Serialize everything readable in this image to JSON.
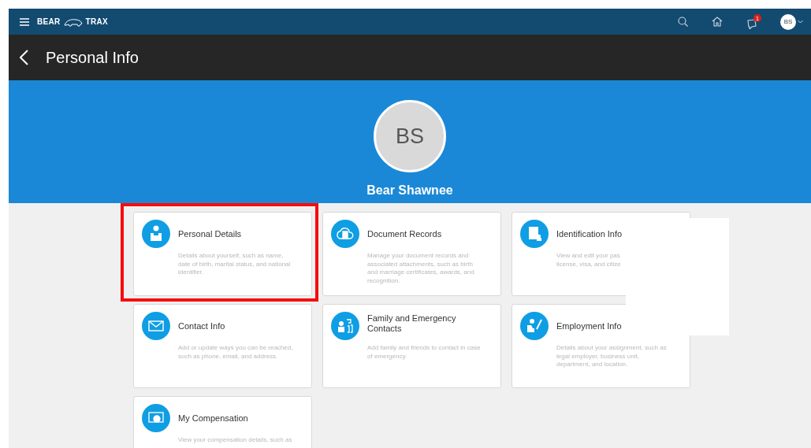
{
  "app_bar": {
    "brand_left": "BEAR",
    "brand_right": "TRAX",
    "notification_count": "1",
    "user_initials": "BS"
  },
  "page": {
    "title": "Personal Info"
  },
  "profile": {
    "initials": "BS",
    "name": "Bear Shawnee"
  },
  "cards": [
    {
      "kind": "person",
      "title": "Personal Details",
      "description_lines": [
        "Details about yourself, such as name,",
        "date of birth, marital status, and national",
        "identifier."
      ],
      "highlighted": true
    },
    {
      "kind": "cloud",
      "title": "Document Records",
      "description_lines": [
        "Manage your document records and",
        "associated attachments, such as birth",
        "and marriage certificates, awards, and",
        "recognition."
      ],
      "highlighted": false
    },
    {
      "kind": "id",
      "title": "Identification Info",
      "description_lines": [
        "View and edit your pas",
        "license, visa, and citize"
      ],
      "highlighted": false
    },
    {
      "kind": "mail",
      "title": "Contact Info",
      "description_lines": [
        "Add or update ways you can be reached,",
        "such as phone, email, and address."
      ],
      "highlighted": false
    },
    {
      "kind": "family",
      "title": "Family and Emergency Contacts",
      "description_lines": [
        "Add family and friends to contact in case",
        "of emergency."
      ],
      "highlighted": false
    },
    {
      "kind": "employment",
      "title": "Employment Info",
      "description_lines": [
        "Details about your assignment, such as",
        "legal employer, business unit,",
        "department, and location."
      ],
      "highlighted": false
    },
    {
      "kind": "money",
      "title": "My Compensation",
      "description_lines": [
        "View your compensation details, such as"
      ],
      "highlighted": false
    }
  ]
}
